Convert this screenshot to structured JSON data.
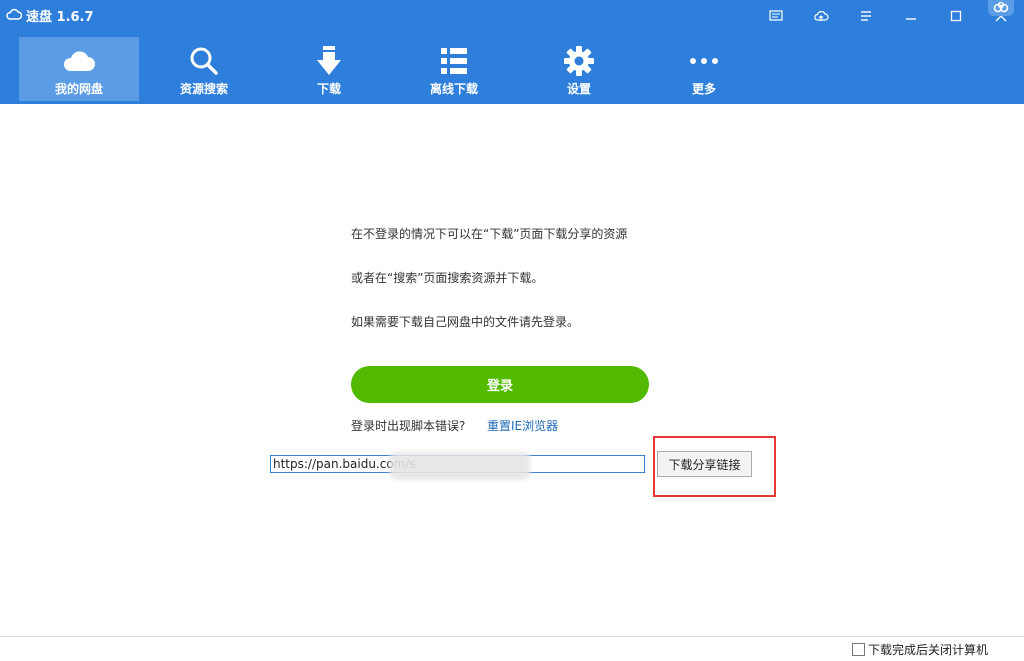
{
  "app": {
    "title": "速盘 1.6.7"
  },
  "nav": {
    "items": [
      {
        "label": "我的网盘"
      },
      {
        "label": "资源搜索"
      },
      {
        "label": "下载"
      },
      {
        "label": "离线下载"
      },
      {
        "label": "设置"
      },
      {
        "label": "更多"
      }
    ],
    "active_index": 0
  },
  "main": {
    "messages": [
      "在不登录的情况下可以在“下载”页面下载分享的资源",
      "或者在“搜索”页面搜索资源并下载。",
      "如果需要下载自己网盘中的文件请先登录。"
    ],
    "login_label": "登录",
    "script_error_text": "登录时出现脚本错误?",
    "reset_ie_label": "重置IE浏览器",
    "share_url": "https://pan.baidu.com/s",
    "download_share_label": "下载分享链接"
  },
  "statusbar": {
    "shutdown_label": "下载完成后关闭计算机",
    "shutdown_checked": false
  },
  "colors": {
    "header_blue": "#2e7fdb",
    "active_tab": "#5b9ce6",
    "login_green": "#52bb00",
    "highlight_red": "#e53935"
  },
  "icons": [
    "cloud-icon",
    "message-icon",
    "upload-cloud-icon",
    "list-icon",
    "minimize-icon",
    "maximize-icon",
    "close-icon",
    "baidu-logo-icon",
    "search-icon",
    "download-arrow-icon",
    "list-grid-icon",
    "gear-icon",
    "more-dots-icon"
  ]
}
